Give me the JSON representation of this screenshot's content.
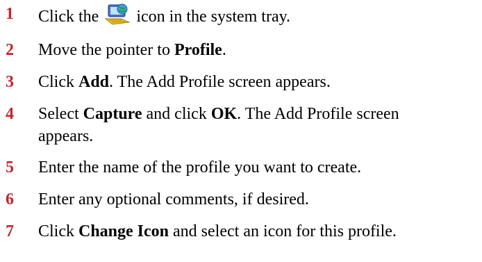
{
  "steps": [
    {
      "num": "1",
      "pre": "Click the",
      "post": "icon in the system tray."
    },
    {
      "num": "2",
      "pre": "Move the pointer to ",
      "bold": "Profile",
      "post": "."
    },
    {
      "num": "3",
      "pre": "Click ",
      "bold": "Add",
      "post": ". The Add Profile screen appears."
    },
    {
      "num": "4",
      "pre": "Select ",
      "bold": "Capture",
      "mid": " and click ",
      "bold2": "OK",
      "post": ". The Add Profile screen",
      "post2": "appears."
    },
    {
      "num": "5",
      "pre": "Enter the name of the profile you want to create."
    },
    {
      "num": "6",
      "pre": "Enter any optional comments, if desired."
    },
    {
      "num": "7",
      "pre": "Click ",
      "bold": "Change Icon",
      "post": " and select an icon for this profile."
    }
  ],
  "icons": {
    "tray": "network-utility-icon"
  },
  "colors": {
    "step_number": "#c0272d",
    "text": "#000000",
    "background": "#ffffff"
  }
}
